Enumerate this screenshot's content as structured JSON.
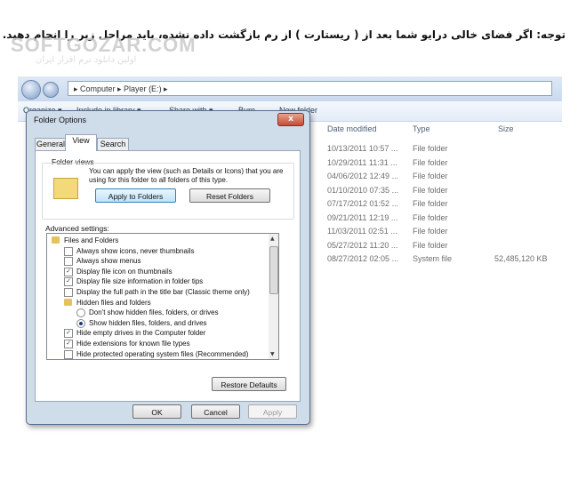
{
  "note": "توجه: اگر فضای خالی درایو شما بعد از ( ریستارت ) از رم بازگشت داده نشده، باید مراحل زیر را انجام دهید.",
  "watermark": "SOFTGOZAR.COM",
  "watermark_sub": "اولین دانلود نرم افزار ایران",
  "explorer": {
    "address": "▸  Computer  ▸  Player (E:)  ▸",
    "toolbar": [
      "Organize ▾",
      "Include in library ▾",
      "Share with ▾",
      "Burn",
      "New folder"
    ],
    "columns": [
      "Date modified",
      "Type",
      "Size"
    ],
    "rows": [
      {
        "date": "10/13/2011 10:57 ...",
        "type": "File folder",
        "size": ""
      },
      {
        "date": "10/29/2011 11:31 ...",
        "type": "File folder",
        "size": ""
      },
      {
        "date": "04/06/2012 12:49 ...",
        "type": "File folder",
        "size": ""
      },
      {
        "date": "01/10/2010 07:35 ...",
        "type": "File folder",
        "size": ""
      },
      {
        "date": "07/17/2012 01:52 ...",
        "type": "File folder",
        "size": ""
      },
      {
        "date": "09/21/2011 12:19 ...",
        "type": "File folder",
        "size": ""
      },
      {
        "date": "11/03/2011 02:51 ...",
        "type": "File folder",
        "size": ""
      },
      {
        "date": "05/27/2012 11:20 ...",
        "type": "File folder",
        "size": ""
      },
      {
        "date": "08/27/2012 02:05 ...",
        "type": "System file",
        "size": "52,485,120 KB"
      }
    ]
  },
  "dialog": {
    "title": "Folder Options",
    "close": "x",
    "tabs": [
      "General",
      "View",
      "Search"
    ],
    "folder_views_label": "Folder views",
    "folder_views_desc": "You can apply the view (such as Details or Icons) that you are using for this folder to all folders of this type.",
    "apply_button": "Apply to Folders",
    "reset_button": "Reset Folders",
    "advanced_label": "Advanced settings:",
    "settings": [
      {
        "kind": "folder",
        "checked": false,
        "text": "Files and Folders",
        "indent": 0
      },
      {
        "kind": "check",
        "checked": false,
        "text": "Always show icons, never thumbnails",
        "indent": 1
      },
      {
        "kind": "check",
        "checked": false,
        "text": "Always show menus",
        "indent": 1
      },
      {
        "kind": "check",
        "checked": true,
        "text": "Display file icon on thumbnails",
        "indent": 1
      },
      {
        "kind": "check",
        "checked": true,
        "text": "Display file size information in folder tips",
        "indent": 1
      },
      {
        "kind": "check",
        "checked": false,
        "text": "Display the full path in the title bar (Classic theme only)",
        "indent": 1
      },
      {
        "kind": "folder",
        "checked": false,
        "text": "Hidden files and folders",
        "indent": 1
      },
      {
        "kind": "radio",
        "checked": false,
        "text": "Don't show hidden files, folders, or drives",
        "indent": 2
      },
      {
        "kind": "radio",
        "checked": true,
        "text": "Show hidden files, folders, and drives",
        "indent": 2
      },
      {
        "kind": "check",
        "checked": true,
        "text": "Hide empty drives in the Computer folder",
        "indent": 1
      },
      {
        "kind": "check",
        "checked": true,
        "text": "Hide extensions for known file types",
        "indent": 1
      },
      {
        "kind": "check",
        "checked": false,
        "text": "Hide protected operating system files (Recommended)",
        "indent": 1
      }
    ],
    "restore_button": "Restore Defaults",
    "ok_button": "OK",
    "cancel_button": "Cancel",
    "apply_bottom_button": "Apply"
  }
}
